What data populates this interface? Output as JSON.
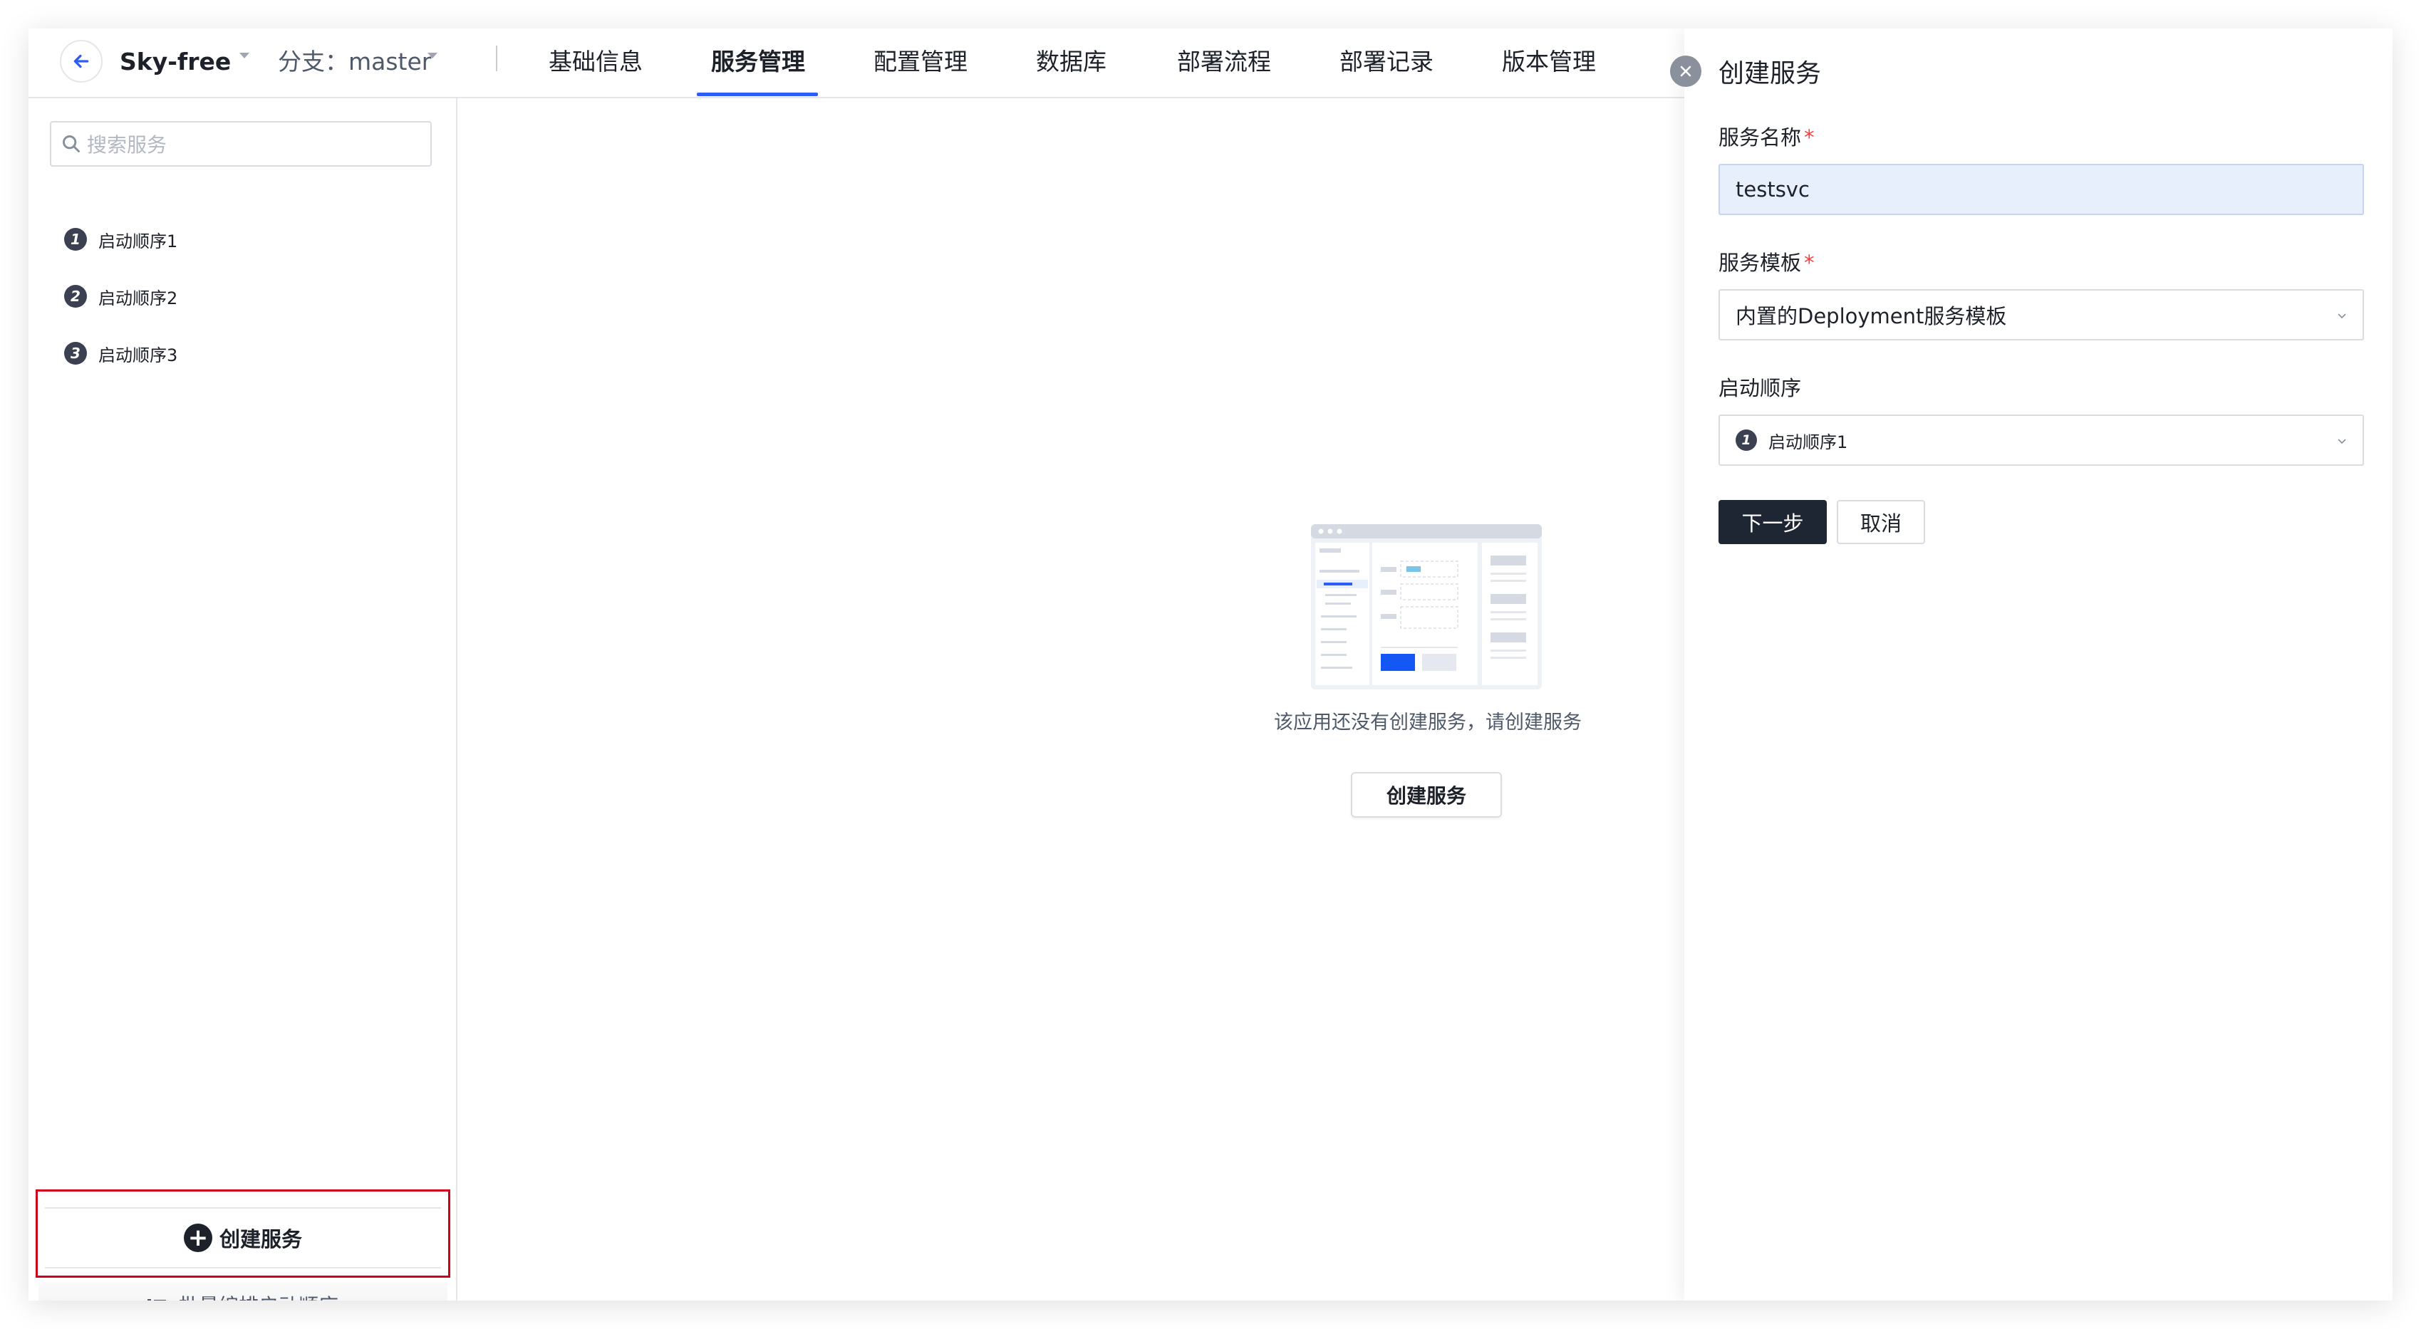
{
  "header": {
    "app_name": "Sky-free",
    "branch_label": "分支：master",
    "tabs": [
      {
        "label": "基础信息",
        "active": false
      },
      {
        "label": "服务管理",
        "active": true
      },
      {
        "label": "配置管理",
        "active": false
      },
      {
        "label": "数据库",
        "active": false
      },
      {
        "label": "部署流程",
        "active": false
      },
      {
        "label": "部署记录",
        "active": false
      },
      {
        "label": "版本管理",
        "active": false
      }
    ]
  },
  "sidebar": {
    "search_placeholder": "搜索服务",
    "start_orders": [
      {
        "num": "1",
        "label": "启动顺序1"
      },
      {
        "num": "2",
        "label": "启动顺序2"
      },
      {
        "num": "3",
        "label": "启动顺序3"
      }
    ],
    "create_service_label": "创建服务",
    "batch_edit_label": "批量编排启动顺序"
  },
  "main": {
    "empty_text": "该应用还没有创建服务，请创建服务",
    "create_button_label": "创建服务"
  },
  "drawer": {
    "title": "创建服务",
    "service_name_label": "服务名称",
    "service_name_value": "testsvc",
    "template_label": "服务模板",
    "template_value": "内置的Deployment服务模板",
    "start_order_label": "启动顺序",
    "start_order_num": "1",
    "start_order_value": "启动顺序1",
    "next_button": "下一步",
    "cancel_button": "取消",
    "required_mark": "*"
  },
  "colors": {
    "accent": "#2d5cf6",
    "primary_button": "#1e2533",
    "required": "#f53f3f",
    "highlight_border": "#d0021b"
  }
}
